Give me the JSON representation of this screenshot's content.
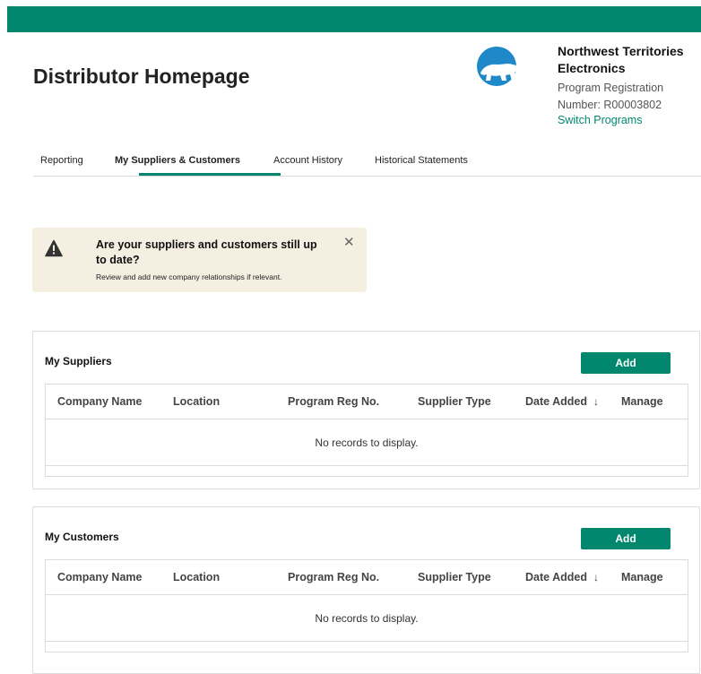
{
  "header": {
    "title": "Distributor Homepage",
    "org_name": "Northwest Territories Electronics",
    "program_reg_text": "Program Registration Number: R00003802",
    "switch_programs": "Switch Programs",
    "logo_icon": "polar-bear-logo-icon",
    "brand_color": "#00876e"
  },
  "tabs": [
    {
      "label": "Reporting",
      "active": false
    },
    {
      "label": "My Suppliers & Customers",
      "active": true
    },
    {
      "label": "Account History",
      "active": false
    },
    {
      "label": "Historical Statements",
      "active": false
    }
  ],
  "alert": {
    "icon": "warning-icon",
    "title": "Are your suppliers and customers still up to date?",
    "message": "Review and add new company relationships if relevant.",
    "close_icon": "close-icon",
    "background": "#f5efe1"
  },
  "suppliers": {
    "title": "My Suppliers",
    "add_label": "Add",
    "columns": [
      "Company Name",
      "Location",
      "Program Reg No.",
      "Supplier Type",
      "Date Added",
      "Manage"
    ],
    "sort_icon": "arrow-down-icon",
    "empty_text": "No records to display."
  },
  "customers": {
    "title": "My Customers",
    "add_label": "Add",
    "columns": [
      "Company Name",
      "Location",
      "Program Reg No.",
      "Supplier Type",
      "Date Added",
      "Manage"
    ],
    "sort_icon": "arrow-down-icon",
    "empty_text": "No records to display."
  }
}
